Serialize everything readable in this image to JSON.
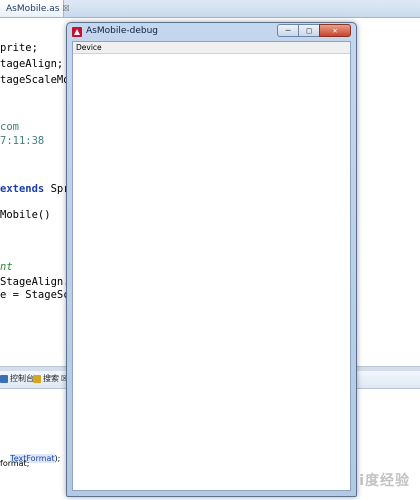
{
  "editor": {
    "tab_label": "AsMobile.as",
    "tab_close": "☒",
    "code": [
      {
        "parts": [
          {
            "t": "prite;",
            "c": "plain"
          }
        ]
      },
      {
        "parts": [
          {
            "t": "tageAlign;",
            "c": "plain"
          }
        ]
      },
      {
        "parts": [
          {
            "t": "tageScaleMod",
            "c": "plain"
          }
        ]
      },
      {
        "parts": [
          {
            "t": "com",
            "c": "cm"
          }
        ]
      },
      {
        "parts": [
          {
            "t": "7:11:38",
            "c": "cm"
          }
        ]
      },
      {
        "parts": [
          {
            "t": "extends",
            "c": "kw"
          },
          {
            "t": " Spri",
            "c": "plain"
          }
        ]
      },
      {
        "parts": [
          {
            "t": "Mobile()",
            "c": "plain"
          }
        ]
      },
      {
        "parts": [
          {
            "t": "nt",
            "c": "ann"
          }
        ]
      },
      {
        "parts": [
          {
            "t": "StageAlign.T",
            "c": "plain"
          }
        ]
      },
      {
        "parts": [
          {
            "t": "e = StageSca",
            "c": "plain"
          }
        ]
      }
    ]
  },
  "bottom_panel": {
    "tab_console": "控制台",
    "tab_search": "搜索",
    "tab_search_close": "☒",
    "line1_pre": "",
    "line1_hl": "TextFormat",
    "line1_post": ");",
    "line2": "format;"
  },
  "debug_window": {
    "title": "AsMobile-debug",
    "menu": {
      "device": "Device"
    },
    "btn_min": "─",
    "btn_max": "□",
    "btn_close": "✕"
  },
  "watermark": "Bai度经验"
}
